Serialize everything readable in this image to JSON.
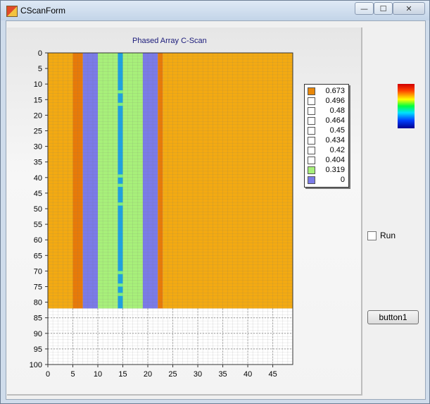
{
  "window": {
    "title": "CScanForm",
    "min_glyph": "—",
    "max_glyph": "☐",
    "close_glyph": "✕"
  },
  "chart": {
    "title": "Phased Array C-Scan"
  },
  "chart_data": {
    "type": "heatmap",
    "title": "Phased Array C-Scan",
    "x_ticks": [
      0,
      5,
      10,
      15,
      20,
      25,
      30,
      35,
      40,
      45
    ],
    "y_ticks": [
      0,
      5,
      10,
      15,
      20,
      25,
      30,
      35,
      40,
      45,
      50,
      55,
      60,
      65,
      70,
      75,
      80,
      85,
      90,
      95,
      100
    ],
    "xlim": [
      0,
      49
    ],
    "ylim": [
      0,
      100
    ],
    "y_inverted": true,
    "data_rows": 82,
    "columns": [
      {
        "range": [
          0,
          5
        ],
        "value": 0.673
      },
      {
        "range": [
          5,
          7
        ],
        "value": 0.673,
        "shade": "dark"
      },
      {
        "range": [
          7,
          10
        ],
        "value": 0
      },
      {
        "range": [
          10,
          14
        ],
        "value": 0.319
      },
      {
        "range": [
          14,
          15
        ],
        "value": 0.404,
        "note": "cyan stripe with light spots"
      },
      {
        "range": [
          15,
          19
        ],
        "value": 0.319
      },
      {
        "range": [
          19,
          22
        ],
        "value": 0
      },
      {
        "range": [
          22,
          23
        ],
        "value": 0.673,
        "shade": "dark"
      },
      {
        "range": [
          23,
          49
        ],
        "value": 0.673
      }
    ],
    "legend": [
      {
        "label": "0.673",
        "color": "#e8870a"
      },
      {
        "label": "0.496",
        "color": "#ffffff"
      },
      {
        "label": "0.48",
        "color": "#ffffff"
      },
      {
        "label": "0.464",
        "color": "#ffffff"
      },
      {
        "label": "0.45",
        "color": "#ffffff"
      },
      {
        "label": "0.434",
        "color": "#ffffff"
      },
      {
        "label": "0.42",
        "color": "#ffffff"
      },
      {
        "label": "0.404",
        "color": "#ffffff"
      },
      {
        "label": "0.319",
        "color": "#a8f07a"
      },
      {
        "label": "0",
        "color": "#7b7be8"
      }
    ],
    "grid": true,
    "legend_position": "right"
  },
  "controls": {
    "run_label": "Run",
    "run_checked": false,
    "button1_label": "button1"
  }
}
